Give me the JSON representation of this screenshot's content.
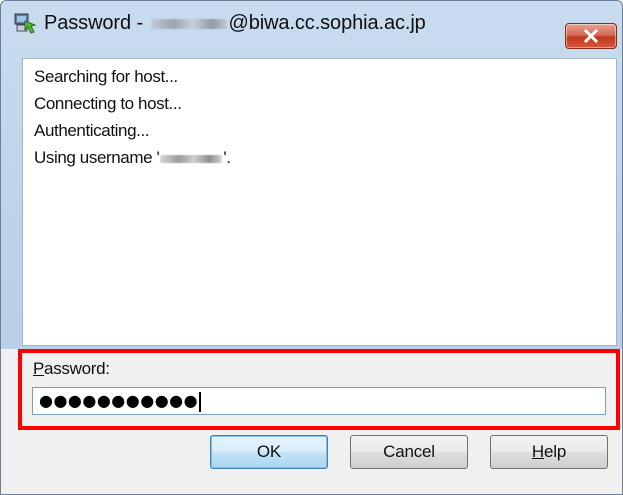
{
  "window": {
    "title_prefix": "Password -",
    "title_suffix": "@biwa.cc.sophia.ac.jp"
  },
  "log": {
    "lines": [
      "Searching for host...",
      "Connecting to host...",
      "Authenticating...",
      "Using username '"
    ],
    "username_suffix": "'."
  },
  "password": {
    "label_underlined": "P",
    "label_rest": "assword:",
    "masked_value": "●●●●●●●●●●●"
  },
  "buttons": {
    "ok": "OK",
    "cancel": "Cancel",
    "help_underlined": "H",
    "help_rest": "elp"
  },
  "icons": {
    "app": "putty-app-icon",
    "close": "close-icon"
  },
  "colors": {
    "highlight": "#ff0000",
    "close_button": "#c7452e"
  }
}
